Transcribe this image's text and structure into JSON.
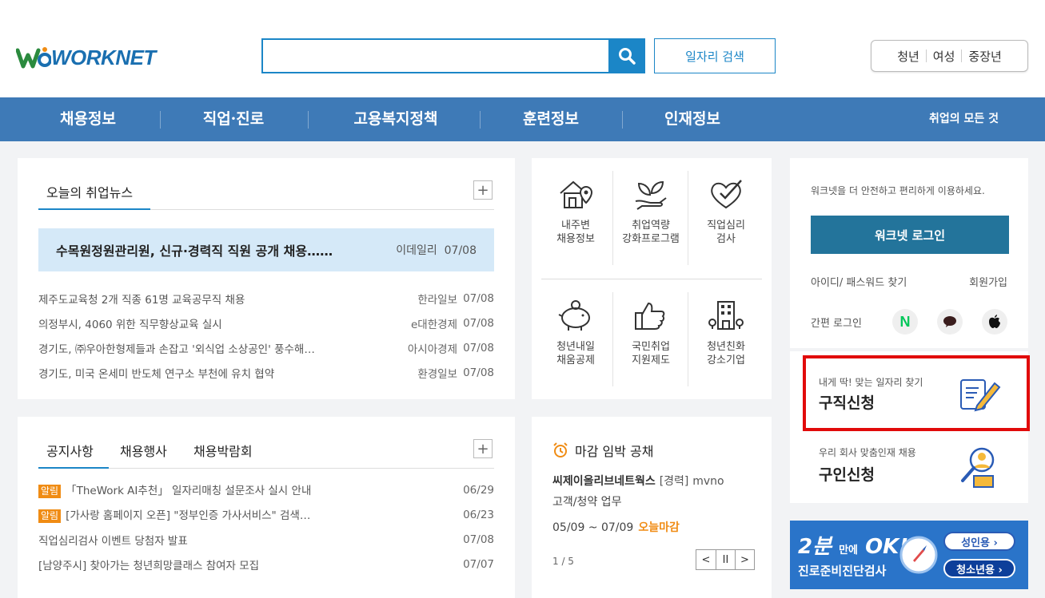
{
  "header": {
    "logo_text": "WORKNET",
    "search_placeholder": "",
    "job_search_label": "일자리 검색",
    "quick_links": [
      "청년",
      "여성",
      "중장년"
    ]
  },
  "nav": {
    "items": [
      "채용정보",
      "직업·진로",
      "고용복지정책",
      "훈련정보",
      "인재정보"
    ],
    "right": "취업의 모든 것"
  },
  "news": {
    "title": "오늘의 취업뉴스",
    "headline": {
      "title": "수목원정원관리원, 신규·경력직 직원 공개 채용……",
      "source": "이데일리",
      "date": "07/08"
    },
    "items": [
      {
        "title": "제주도교육청 2개 직종 61명 교육공무직 채용",
        "source": "한라일보",
        "date": "07/08"
      },
      {
        "title": "의정부시, 4060 위한 직무향상교육 실시",
        "source": "e대한경제",
        "date": "07/08"
      },
      {
        "title": "경기도, ㈜우아한형제들과 손잡고 '외식업 소상공인' 풍수해…",
        "source": "아시아경제",
        "date": "07/08"
      },
      {
        "title": "경기도, 미국 온세미 반도체 연구소 부천에 유치 협약",
        "source": "환경일보",
        "date": "07/08"
      }
    ]
  },
  "notice": {
    "tabs": [
      "공지사항",
      "채용행사",
      "채용박람회"
    ],
    "badge": "알림",
    "items": [
      {
        "badge": true,
        "title": "「TheWork AI추천」 일자리매칭 설문조사 실시 안내",
        "date": "06/29"
      },
      {
        "badge": true,
        "title": "[가사랑 홈페이지 오픈] \"정부인증 가사서비스\" 검색…",
        "date": "06/23"
      },
      {
        "badge": false,
        "title": "직업심리검사 이벤트 당첨자 발표",
        "date": "07/08"
      },
      {
        "badge": false,
        "title": "[남양주시] 찾아가는 청년희망클래스 참여자 모집",
        "date": "07/07"
      }
    ]
  },
  "services": [
    {
      "label": "내주변\n채용정보",
      "icon": "house-location-icon"
    },
    {
      "label": "취업역량\n강화프로그램",
      "icon": "sprout-hand-icon"
    },
    {
      "label": "직업심리\n검사",
      "icon": "heart-check-icon"
    },
    {
      "label": "청년내일\n채움공제",
      "icon": "piggy-bank-icon"
    },
    {
      "label": "국민취업\n지원제도",
      "icon": "thumbs-up-icon"
    },
    {
      "label": "청년친화\n강소기업",
      "icon": "building-icon"
    }
  ],
  "deadline": {
    "title": "마감 임박 공채",
    "company": "씨제이올리브네트웍스",
    "tag": "[경력]",
    "role_inline": "mvno",
    "desc": "고객/청약 업무",
    "date_range": "05/09 ~ 07/09",
    "today_label": "오늘마감",
    "page": "1 / 5",
    "pager": [
      "<",
      "II",
      ">"
    ]
  },
  "login": {
    "message": "워크넷을 더 안전하고 편리하게 이용하세요.",
    "button": "워크넷 로그인",
    "find": "아이디/ 패스워드 찾기",
    "join": "회원가입",
    "easy": "간편 로그인",
    "social": [
      "N",
      "talk-bubble-icon",
      "apple-icon"
    ]
  },
  "apply": {
    "seek_sub": "내게 딱! 맞는 일자리 찾기",
    "seek_main": "구직신청",
    "hire_sub": "우리 회사 맞춤인재 채용",
    "hire_main": "구인신청"
  },
  "banner": {
    "big": "2분",
    "small": "만에",
    "ok": "OK!",
    "sub": "진로준비진단검사",
    "adult": "성인용 ›",
    "youth": "청소년용 ›"
  },
  "colors": {
    "brand_blue": "#3e7ab7",
    "accent": "#1b86c7",
    "highlight": "#e10a0a",
    "orange": "#f08c14"
  }
}
